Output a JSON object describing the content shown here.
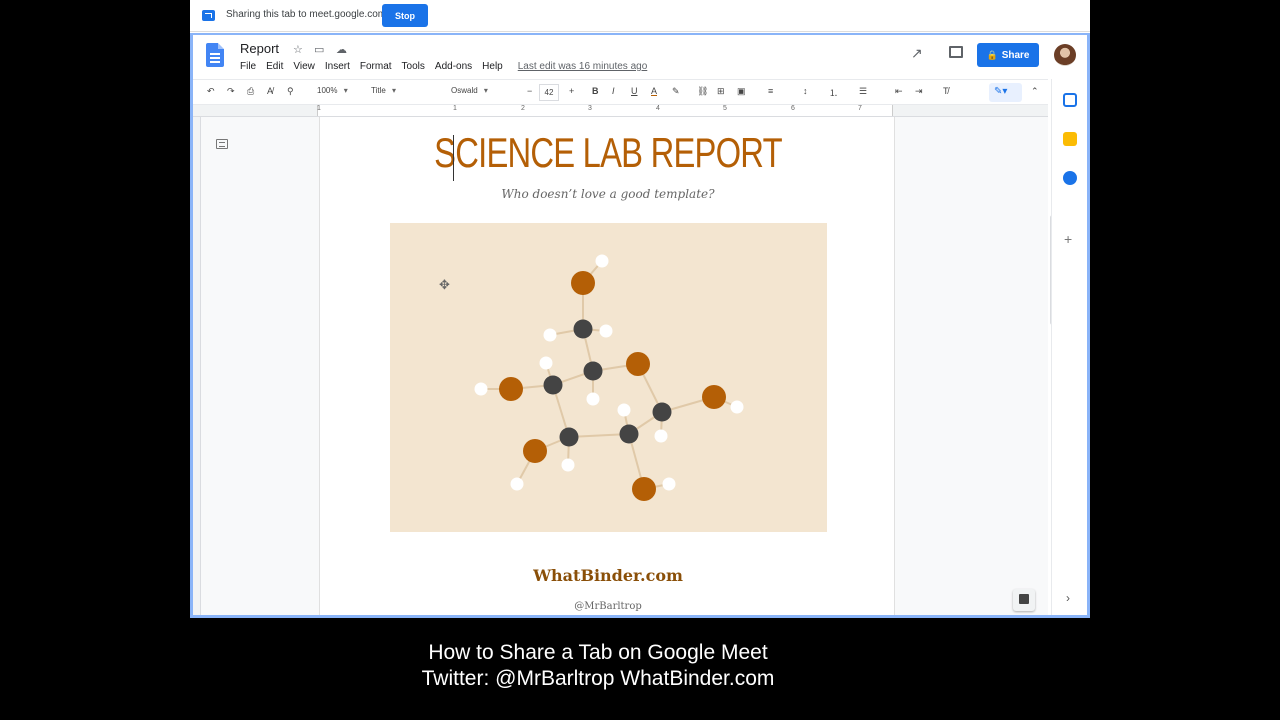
{
  "sharebar": {
    "text": "Sharing this tab to meet.google.com",
    "stop_label": "Stop"
  },
  "doc": {
    "title": "Report",
    "menu": [
      "File",
      "Edit",
      "View",
      "Insert",
      "Format",
      "Tools",
      "Add-ons",
      "Help"
    ],
    "last_edit": "Last edit was 16 minutes ago",
    "share_label": "Share"
  },
  "toolbar": {
    "zoom": "100%",
    "style": "Title",
    "font": "Oswald",
    "size": "42"
  },
  "ruler": {
    "marks": [
      "1",
      "1",
      "2",
      "3",
      "4",
      "5",
      "6",
      "7"
    ]
  },
  "page": {
    "title": "SCIENCE LAB REPORT",
    "subtitle": "Who doesn’t love a good template?",
    "site": "WhatBinder.com",
    "handle": "@MrBarltrop"
  },
  "caption": {
    "line1": "How to Share a Tab on Google Meet",
    "line2": "Twitter: @MrBarltrop WhatBinder.com"
  },
  "colors": {
    "accent": "#b45f06",
    "blue": "#1a73e8",
    "image_bg": "#f3e5d0"
  }
}
